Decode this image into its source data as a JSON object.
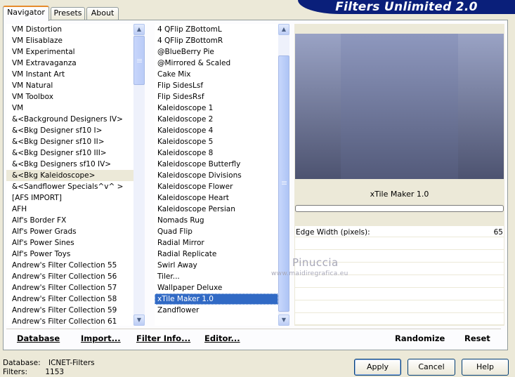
{
  "tabs": [
    {
      "label": "Navigator"
    },
    {
      "label": "Presets"
    },
    {
      "label": "About"
    }
  ],
  "title_banner": "Filters Unlimited 2.0",
  "categories": [
    "VM Distortion",
    "VM Elisablaze",
    "VM Experimental",
    "VM Extravaganza",
    "VM Instant Art",
    "VM Natural",
    "VM Toolbox",
    "VM",
    "&<Background Designers IV>",
    "&<Bkg Designer sf10 I>",
    "&<Bkg Designer sf10 II>",
    "&<Bkg Designer sf10 III>",
    "&<Bkg Designers sf10 IV>",
    "&<Bkg Kaleidoscope>",
    "&<Sandflower Specials^v^ >",
    "[AFS IMPORT]",
    "AFH",
    "Alf's Border FX",
    "Alf's Power Grads",
    "Alf's Power Sines",
    "Alf's Power Toys",
    "Andrew's Filter Collection 55",
    "Andrew's Filter Collection 56",
    "Andrew's Filter Collection 57",
    "Andrew's Filter Collection 58",
    "Andrew's Filter Collection 59",
    "Andrew's Filter Collection 61"
  ],
  "selected_category": "&<Bkg Kaleidoscope>",
  "filters": [
    "4 QFlip ZBottomL",
    "4 QFlip ZBottomR",
    "@BlueBerry Pie",
    "@Mirrored & Scaled",
    "Cake Mix",
    "Flip SidesLsf",
    "Flip SidesRsf",
    "Kaleidoscope 1",
    "Kaleidoscope 2",
    "Kaleidoscope 4",
    "Kaleidoscope 5",
    "Kaleidoscope 8",
    "Kaleidoscope Butterfly",
    "Kaleidoscope Divisions",
    "Kaleidoscope Flower",
    "Kaleidoscope Heart",
    "Kaleidoscope Persian",
    "Nomads Rug",
    "Quad Flip",
    "Radial Mirror",
    "Radial Replicate",
    "Swirl Away",
    "Tiler...",
    "Wallpaper Deluxe",
    "xTile Maker 1.0",
    "Zandflower"
  ],
  "selected_filter": "xTile Maker 1.0",
  "filter_title": "xTile Maker 1.0",
  "parameter": {
    "label": "Edge Width (pixels):",
    "value": "65"
  },
  "watermark": {
    "name": "Pinuccia",
    "site": "www.maidiregrafica.eu"
  },
  "toolbar": {
    "database": "Database",
    "import": "Import...",
    "filter_info": "Filter Info...",
    "editor": "Editor...",
    "randomize": "Randomize",
    "reset": "Reset"
  },
  "status": {
    "database_label": "Database:",
    "database_value": "ICNET-Filters",
    "filters_label": "Filters:",
    "filters_value": "1153"
  },
  "buttons": {
    "apply": "Apply",
    "cancel": "Cancel",
    "help": "Help"
  },
  "colors": {
    "banner": "#0a1f7a",
    "selection": "#316ac5",
    "dialog_bg": "#ece9d8"
  }
}
